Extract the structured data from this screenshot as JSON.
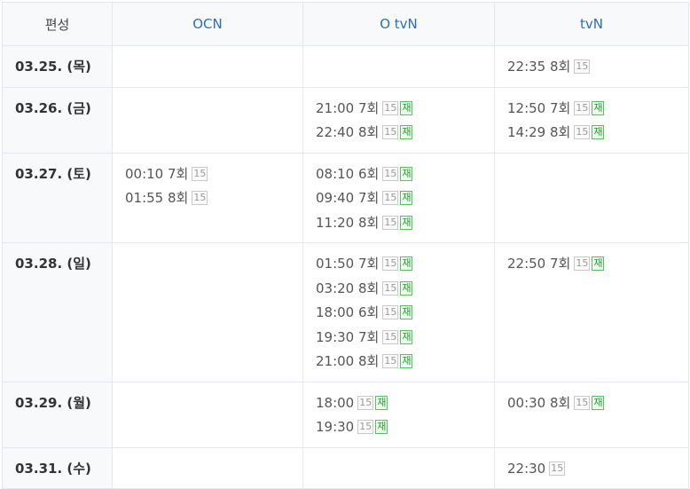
{
  "header": {
    "corner": "편성",
    "channels": [
      "OCN",
      "O tvN",
      "tvN"
    ]
  },
  "badges": {
    "age": "15",
    "rerun": "재"
  },
  "rows": [
    {
      "date": "03.25. (목)",
      "OCN": [],
      "OtvN": [],
      "tvN": [
        {
          "time": "22:35",
          "ep": "8회",
          "rerun": false
        }
      ]
    },
    {
      "date": "03.26. (금)",
      "OCN": [],
      "OtvN": [
        {
          "time": "21:00",
          "ep": "7회",
          "rerun": true
        },
        {
          "time": "22:40",
          "ep": "8회",
          "rerun": true
        }
      ],
      "tvN": [
        {
          "time": "12:50",
          "ep": "7회",
          "rerun": true
        },
        {
          "time": "14:29",
          "ep": "8회",
          "rerun": true
        }
      ]
    },
    {
      "date": "03.27. (토)",
      "OCN": [
        {
          "time": "00:10",
          "ep": "7회",
          "rerun": false
        },
        {
          "time": "01:55",
          "ep": "8회",
          "rerun": false
        }
      ],
      "OtvN": [
        {
          "time": "08:10",
          "ep": "6회",
          "rerun": true
        },
        {
          "time": "09:40",
          "ep": "7회",
          "rerun": true
        },
        {
          "time": "11:20",
          "ep": "8회",
          "rerun": true
        }
      ],
      "tvN": []
    },
    {
      "date": "03.28. (일)",
      "OCN": [],
      "OtvN": [
        {
          "time": "01:50",
          "ep": "7회",
          "rerun": true
        },
        {
          "time": "03:20",
          "ep": "8회",
          "rerun": true
        },
        {
          "time": "18:00",
          "ep": "6회",
          "rerun": true
        },
        {
          "time": "19:30",
          "ep": "7회",
          "rerun": true
        },
        {
          "time": "21:00",
          "ep": "8회",
          "rerun": true
        }
      ],
      "tvN": [
        {
          "time": "22:50",
          "ep": "7회",
          "rerun": true
        }
      ]
    },
    {
      "date": "03.29. (월)",
      "OCN": [],
      "OtvN": [
        {
          "time": "18:00",
          "ep": "",
          "rerun": true
        },
        {
          "time": "19:30",
          "ep": "",
          "rerun": true
        }
      ],
      "tvN": [
        {
          "time": "00:30",
          "ep": "8회",
          "rerun": true
        }
      ]
    },
    {
      "date": "03.31. (수)",
      "OCN": [],
      "OtvN": [],
      "tvN": [
        {
          "time": "22:30",
          "ep": "",
          "rerun": false
        }
      ]
    }
  ]
}
